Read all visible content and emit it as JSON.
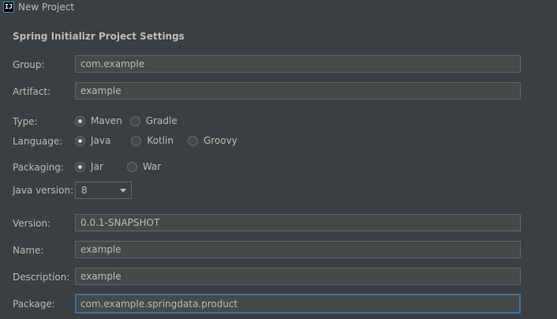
{
  "window": {
    "title": "New Project"
  },
  "section": {
    "title": "Spring Initializr Project Settings"
  },
  "fields": {
    "group": {
      "label": "Group:",
      "value": "com.example"
    },
    "artifact": {
      "label": "Artifact:",
      "value": "example"
    },
    "version": {
      "label": "Version:",
      "value": "0.0.1-SNAPSHOT"
    },
    "name": {
      "label": "Name:",
      "value": "example"
    },
    "description": {
      "label": "Description:",
      "value": "example"
    },
    "package": {
      "label": "Package:",
      "value": "com.example.springdata.product"
    }
  },
  "type": {
    "label": "Type:",
    "options": [
      "Maven",
      "Gradle"
    ],
    "selected": "Maven"
  },
  "language": {
    "label": "Language:",
    "options": [
      "Java",
      "Kotlin",
      "Groovy"
    ],
    "selected": "Java"
  },
  "packaging": {
    "label": "Packaging:",
    "options": [
      "Jar",
      "War"
    ],
    "selected": "Jar"
  },
  "java_version": {
    "label": "Java version:",
    "selected": "8"
  },
  "icons": {
    "app": "intellij-idea-icon",
    "dropdown": "chevron-down-icon"
  },
  "colors": {
    "background": "#3c3f41",
    "field_background": "#45494a",
    "focus_border": "#466d94",
    "text": "#bbbbbb"
  }
}
